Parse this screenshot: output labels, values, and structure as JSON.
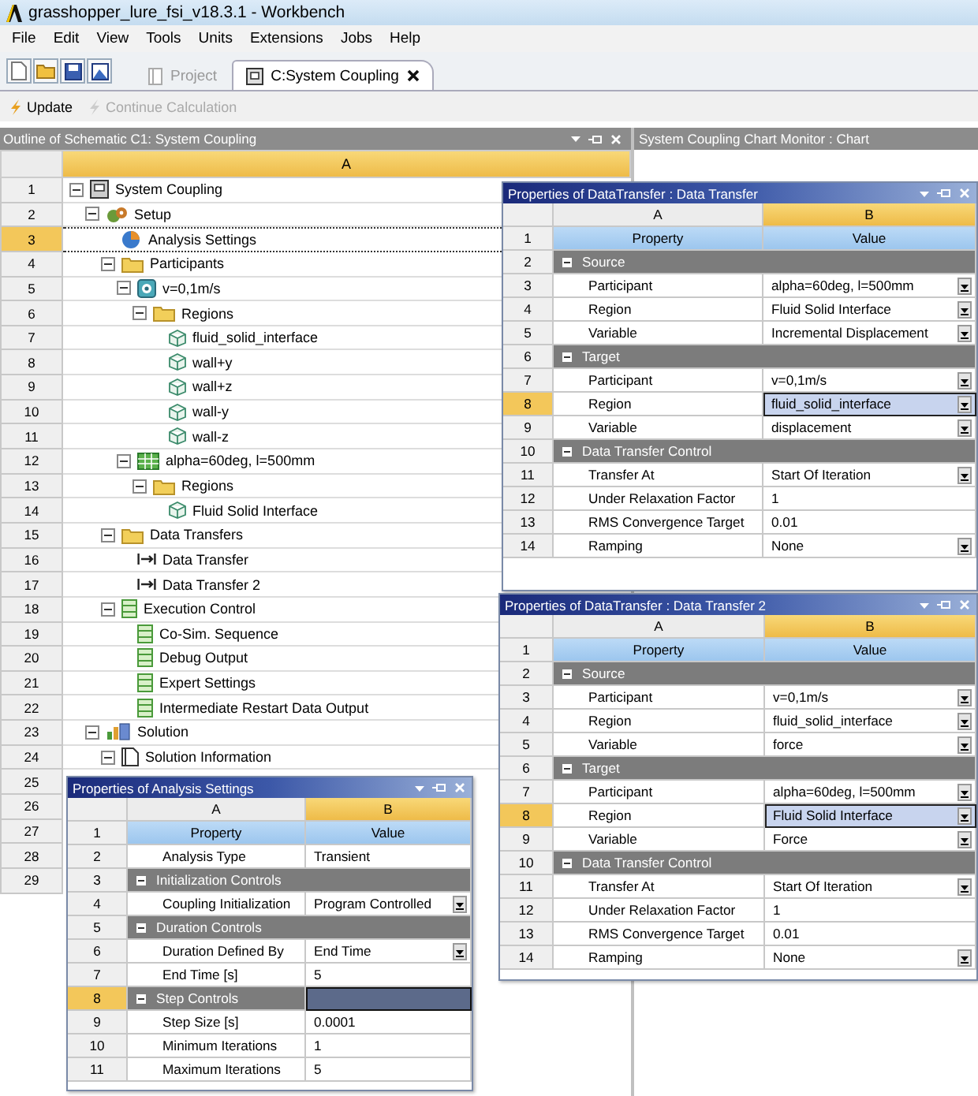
{
  "window": {
    "title": "grasshopper_lure_fsi_v18.3.1 - Workbench"
  },
  "menu": [
    "File",
    "Edit",
    "View",
    "Tools",
    "Units",
    "Extensions",
    "Jobs",
    "Help"
  ],
  "tabs": [
    {
      "label": "Project",
      "selected": false,
      "disabled": true
    },
    {
      "label": "C:System Coupling",
      "selected": true,
      "disabled": false
    }
  ],
  "actions": [
    {
      "label": "Update",
      "disabled": false
    },
    {
      "label": "Continue Calculation",
      "disabled": true
    }
  ],
  "outline": {
    "title": "Outline of Schematic C1: System Coupling",
    "column": "A",
    "rows": [
      {
        "row": "1",
        "label": "System Coupling",
        "kind": "system",
        "expanded": true,
        "selected": false,
        "children": [
          {
            "row": "2",
            "label": "Setup",
            "kind": "setup",
            "expanded": true,
            "selected": false,
            "children": [
              {
                "row": "3",
                "label": "Analysis Settings",
                "kind": "settings",
                "selected": true
              },
              {
                "row": "4",
                "label": "Participants",
                "kind": "folder",
                "expanded": true,
                "selected": false,
                "children": [
                  {
                    "row": "5",
                    "label": "v=0,1m/s",
                    "kind": "fluid",
                    "expanded": true,
                    "selected": false,
                    "children": [
                      {
                        "row": "6",
                        "label": "Regions",
                        "kind": "folder",
                        "expanded": true,
                        "selected": false,
                        "children": [
                          {
                            "row": "7",
                            "label": "fluid_solid_interface",
                            "kind": "region",
                            "selected": false
                          },
                          {
                            "row": "8",
                            "label": "wall+y",
                            "kind": "region",
                            "selected": false
                          },
                          {
                            "row": "9",
                            "label": "wall+z",
                            "kind": "region",
                            "selected": false
                          },
                          {
                            "row": "10",
                            "label": "wall-y",
                            "kind": "region",
                            "selected": false
                          },
                          {
                            "row": "11",
                            "label": "wall-z",
                            "kind": "region",
                            "selected": false
                          }
                        ]
                      }
                    ]
                  },
                  {
                    "row": "12",
                    "label": "alpha=60deg, l=500mm",
                    "kind": "solid",
                    "expanded": true,
                    "selected": false,
                    "children": [
                      {
                        "row": "13",
                        "label": "Regions",
                        "kind": "folder",
                        "expanded": true,
                        "selected": false,
                        "children": [
                          {
                            "row": "14",
                            "label": "Fluid Solid Interface",
                            "kind": "region",
                            "selected": false
                          }
                        ]
                      }
                    ]
                  }
                ]
              },
              {
                "row": "15",
                "label": "Data Transfers",
                "kind": "folder",
                "expanded": true,
                "selected": false,
                "children": [
                  {
                    "row": "16",
                    "label": "Data Transfer",
                    "kind": "transfer",
                    "selected": false
                  },
                  {
                    "row": "17",
                    "label": "Data Transfer 2",
                    "kind": "transfer",
                    "selected": false
                  }
                ]
              },
              {
                "row": "18",
                "label": "Execution Control",
                "kind": "list",
                "expanded": true,
                "selected": false,
                "children": [
                  {
                    "row": "19",
                    "label": "Co-Sim. Sequence",
                    "kind": "list",
                    "selected": false
                  },
                  {
                    "row": "20",
                    "label": "Debug Output",
                    "kind": "list",
                    "selected": false
                  },
                  {
                    "row": "21",
                    "label": "Expert Settings",
                    "kind": "list",
                    "selected": false
                  },
                  {
                    "row": "22",
                    "label": "Intermediate Restart Data Output",
                    "kind": "list",
                    "selected": false
                  }
                ]
              }
            ]
          },
          {
            "row": "23",
            "label": "Solution",
            "kind": "solution",
            "expanded": true,
            "selected": false,
            "children": [
              {
                "row": "24",
                "label": "Solution Information",
                "kind": "info",
                "expanded": true,
                "selected": false
              }
            ]
          }
        ]
      }
    ],
    "empty_rows": [
      "25",
      "26",
      "27",
      "28",
      "29"
    ]
  },
  "chart_monitor": {
    "title": "System Coupling Chart Monitor : Chart"
  },
  "property_panels": [
    {
      "title": "Properties of DataTransfer : Data Transfer",
      "columns": [
        "A",
        "B"
      ],
      "rows": [
        {
          "number": "1",
          "kind": "header",
          "label": "Property",
          "value": "Value",
          "selected": false
        },
        {
          "number": "2",
          "kind": "category",
          "label": "Source",
          "expanded": true,
          "selected": false
        },
        {
          "number": "3",
          "kind": "property",
          "label": "Participant",
          "value": "alpha=60deg, l=500mm",
          "dropdown": true,
          "selected": false
        },
        {
          "number": "4",
          "kind": "property",
          "label": "Region",
          "value": "Fluid Solid Interface",
          "dropdown": true,
          "selected": false
        },
        {
          "number": "5",
          "kind": "property",
          "label": "Variable",
          "value": "Incremental Displacement",
          "dropdown": true,
          "selected": false
        },
        {
          "number": "6",
          "kind": "category",
          "label": "Target",
          "expanded": true,
          "selected": false
        },
        {
          "number": "7",
          "kind": "property",
          "label": "Participant",
          "value": "v=0,1m/s",
          "dropdown": true,
          "selected": false
        },
        {
          "number": "8",
          "kind": "property",
          "label": "Region",
          "value": "fluid_solid_interface",
          "dropdown": true,
          "selected": true
        },
        {
          "number": "9",
          "kind": "property",
          "label": "Variable",
          "value": "displacement",
          "dropdown": true,
          "selected": false
        },
        {
          "number": "10",
          "kind": "category",
          "label": "Data Transfer Control",
          "expanded": true,
          "selected": false
        },
        {
          "number": "11",
          "kind": "property",
          "label": "Transfer At",
          "value": "Start Of Iteration",
          "dropdown": true,
          "selected": false
        },
        {
          "number": "12",
          "kind": "property",
          "label": "Under Relaxation Factor",
          "value": "1",
          "dropdown": false,
          "selected": false
        },
        {
          "number": "13",
          "kind": "property",
          "label": "RMS Convergence Target",
          "value": "0.01",
          "dropdown": false,
          "selected": false
        },
        {
          "number": "14",
          "kind": "property",
          "label": "Ramping",
          "value": "None",
          "dropdown": true,
          "selected": false
        }
      ]
    },
    {
      "title": "Properties of DataTransfer : Data Transfer 2",
      "columns": [
        "A",
        "B"
      ],
      "rows": [
        {
          "number": "1",
          "kind": "header",
          "label": "Property",
          "value": "Value",
          "selected": false
        },
        {
          "number": "2",
          "kind": "category",
          "label": "Source",
          "expanded": true,
          "selected": false
        },
        {
          "number": "3",
          "kind": "property",
          "label": "Participant",
          "value": "v=0,1m/s",
          "dropdown": true,
          "selected": false
        },
        {
          "number": "4",
          "kind": "property",
          "label": "Region",
          "value": "fluid_solid_interface",
          "dropdown": true,
          "selected": false
        },
        {
          "number": "5",
          "kind": "property",
          "label": "Variable",
          "value": "force",
          "dropdown": true,
          "selected": false
        },
        {
          "number": "6",
          "kind": "category",
          "label": "Target",
          "expanded": true,
          "selected": false
        },
        {
          "number": "7",
          "kind": "property",
          "label": "Participant",
          "value": "alpha=60deg, l=500mm",
          "dropdown": true,
          "selected": false
        },
        {
          "number": "8",
          "kind": "property",
          "label": "Region",
          "value": "Fluid Solid Interface",
          "dropdown": true,
          "selected": true
        },
        {
          "number": "9",
          "kind": "property",
          "label": "Variable",
          "value": "Force",
          "dropdown": true,
          "selected": false
        },
        {
          "number": "10",
          "kind": "category",
          "label": "Data Transfer Control",
          "expanded": true,
          "selected": false
        },
        {
          "number": "11",
          "kind": "property",
          "label": "Transfer At",
          "value": "Start Of Iteration",
          "dropdown": true,
          "selected": false
        },
        {
          "number": "12",
          "kind": "property",
          "label": "Under Relaxation Factor",
          "value": "1",
          "dropdown": false,
          "selected": false
        },
        {
          "number": "13",
          "kind": "property",
          "label": "RMS Convergence Target",
          "value": "0.01",
          "dropdown": false,
          "selected": false
        },
        {
          "number": "14",
          "kind": "property",
          "label": "Ramping",
          "value": "None",
          "dropdown": true,
          "selected": false
        }
      ]
    },
    {
      "title": "Properties of Analysis Settings",
      "columns": [
        "A",
        "B"
      ],
      "rows": [
        {
          "number": "1",
          "kind": "header",
          "label": "Property",
          "value": "Value",
          "selected": false
        },
        {
          "number": "2",
          "kind": "property",
          "label": "Analysis Type",
          "value": "Transient",
          "dropdown": false,
          "selected": false
        },
        {
          "number": "3",
          "kind": "category",
          "label": "Initialization Controls",
          "expanded": true,
          "selected": false
        },
        {
          "number": "4",
          "kind": "property",
          "label": "Coupling Initialization",
          "value": "Program Controlled",
          "dropdown": true,
          "selected": false
        },
        {
          "number": "5",
          "kind": "category",
          "label": "Duration Controls",
          "expanded": true,
          "selected": false
        },
        {
          "number": "6",
          "kind": "property",
          "label": "Duration Defined By",
          "value": "End Time",
          "dropdown": true,
          "selected": false
        },
        {
          "number": "7",
          "kind": "property",
          "label": "End Time [s]",
          "value": "5",
          "dropdown": false,
          "selected": false
        },
        {
          "number": "8",
          "kind": "category",
          "label": "Step Controls",
          "expanded": true,
          "selected": true
        },
        {
          "number": "9",
          "kind": "property",
          "label": "Step Size [s]",
          "value": "0.0001",
          "dropdown": false,
          "selected": false
        },
        {
          "number": "10",
          "kind": "property",
          "label": "Minimum Iterations",
          "value": "1",
          "dropdown": false,
          "selected": false
        },
        {
          "number": "11",
          "kind": "property",
          "label": "Maximum Iterations",
          "value": "5",
          "dropdown": false,
          "selected": false
        }
      ]
    }
  ]
}
